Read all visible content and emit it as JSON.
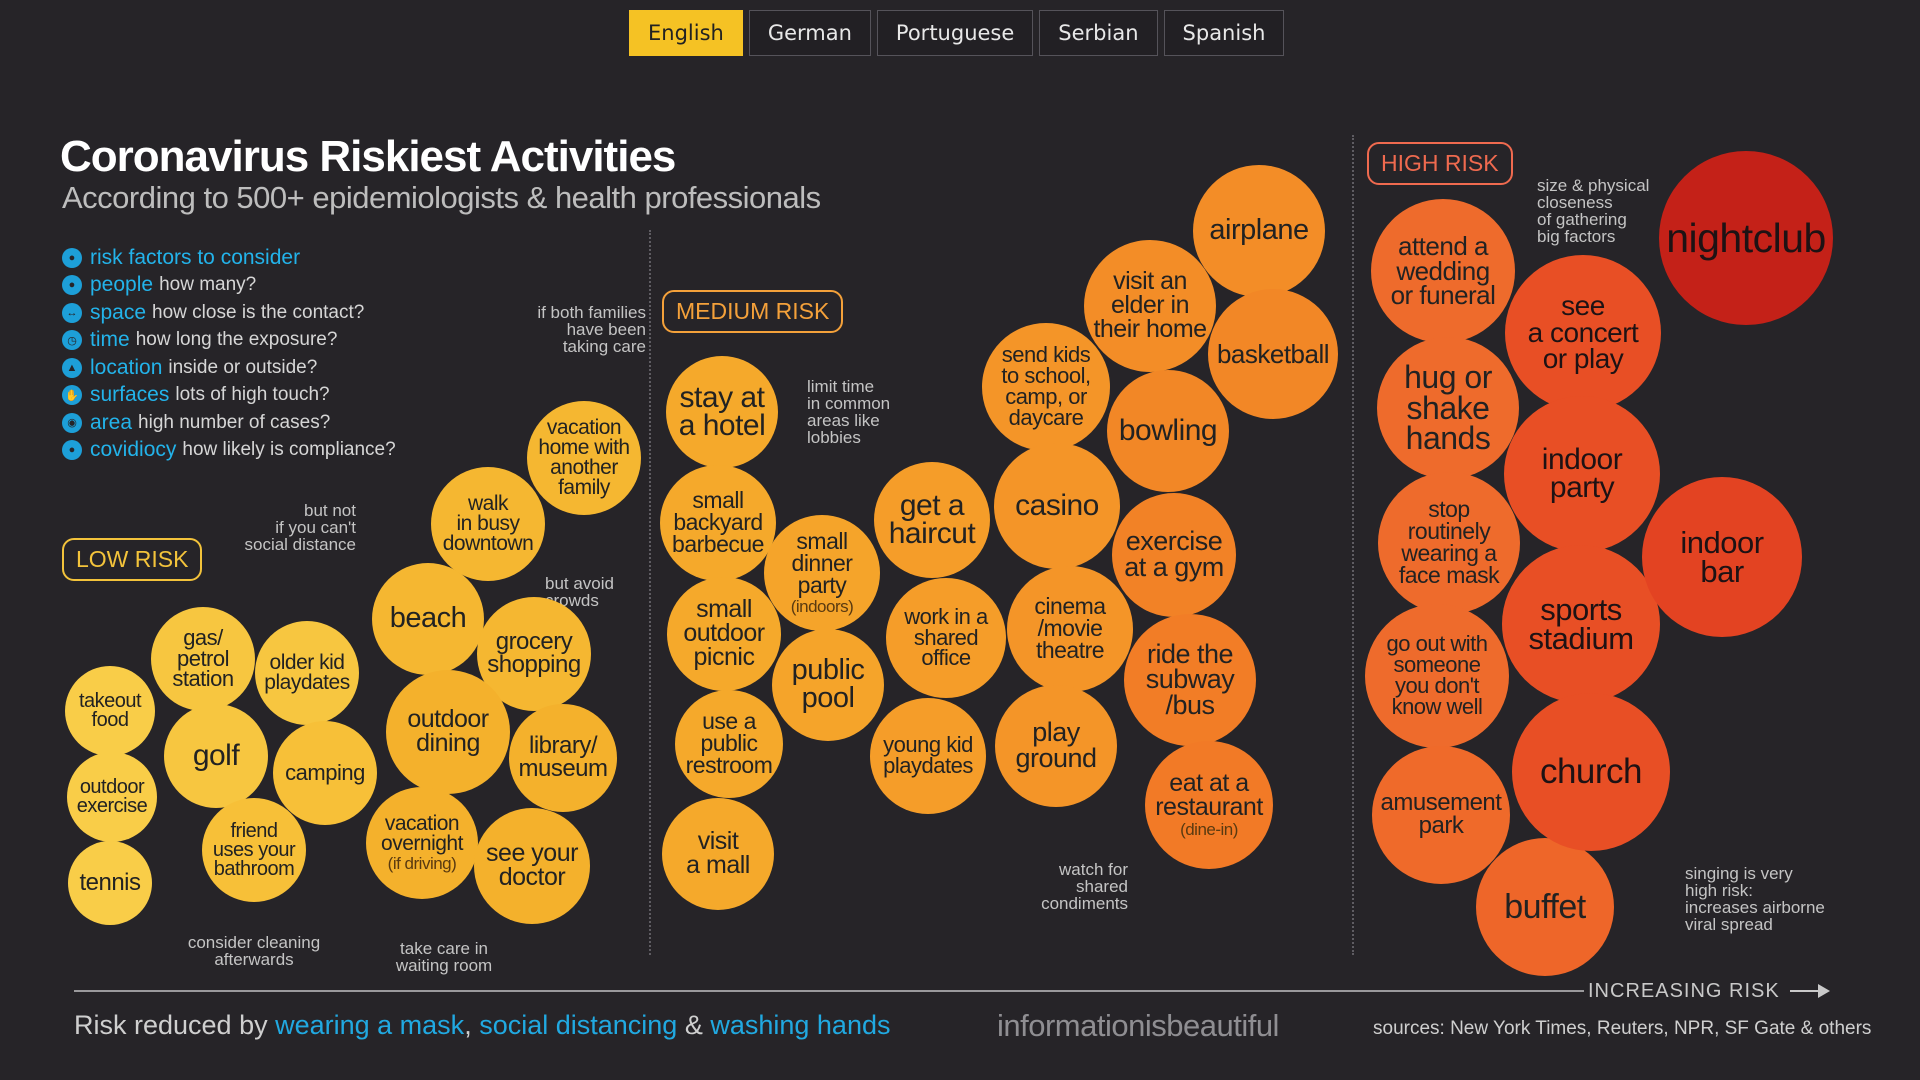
{
  "languages": [
    "English",
    "German",
    "Portuguese",
    "Serbian",
    "Spanish"
  ],
  "title": "Coronavirus Riskiest Activities",
  "subtitle": "According to 500+ epidemiologists & health professionals",
  "risk_factors": [
    {
      "key": "risk factors to consider",
      "desc": ""
    },
    {
      "key": "people",
      "desc": "how many?"
    },
    {
      "key": "space",
      "desc": "how close is the contact?"
    },
    {
      "key": "time",
      "desc": "how long the exposure?"
    },
    {
      "key": "location",
      "desc": "inside or outside?"
    },
    {
      "key": "surfaces",
      "desc": "lots of high touch?"
    },
    {
      "key": "area",
      "desc": "high number of cases?"
    },
    {
      "key": "covidiocy",
      "desc": "how likely is compliance?"
    }
  ],
  "risk_labels": {
    "low": "LOW RISK",
    "medium": "MEDIUM RISK",
    "high": "HIGH RISK"
  },
  "notes": {
    "both_families": "if both families\nhave been\ntaking care",
    "but_not": "but not\nif you can't\nsocial distance",
    "avoid_crowds": "but avoid\ncrowds",
    "cleaning": "consider cleaning\nafterwards",
    "waiting_room": "take care in\nwaiting room",
    "limit_time": "limit time\nin common\nareas like\nlobbies",
    "condiments": "watch for\nshared\ncondiments",
    "gathering": "size & physical\ncloseness\nof gathering\nbig factors",
    "singing": "singing is very\nhigh risk:\nincreases airborne\nviral spread"
  },
  "activities": [
    {
      "label": "takeout\nfood",
      "sub": "",
      "level": "low",
      "color": "#f9cd48"
    },
    {
      "label": "outdoor\nexercise",
      "sub": "",
      "level": "low",
      "color": "#f9cd48"
    },
    {
      "label": "tennis",
      "sub": "",
      "level": "low",
      "color": "#f9cd48"
    },
    {
      "label": "gas/\npetrol\nstation",
      "sub": "",
      "level": "low",
      "color": "#f7c640"
    },
    {
      "label": "golf",
      "sub": "",
      "level": "low",
      "color": "#f7c640"
    },
    {
      "label": "older kid\nplaydates",
      "sub": "",
      "level": "low",
      "color": "#f7c640"
    },
    {
      "label": "camping",
      "sub": "",
      "level": "low",
      "color": "#f7c038"
    },
    {
      "label": "friend\nuses your\nbathroom",
      "sub": "",
      "level": "low",
      "color": "#f7c038"
    },
    {
      "label": "beach",
      "sub": "",
      "level": "low",
      "color": "#f5b731"
    },
    {
      "label": "walk\nin busy\ndowntown",
      "sub": "",
      "level": "low",
      "color": "#f5b731"
    },
    {
      "label": "vacation\nhome with\nanother\nfamily",
      "sub": "",
      "level": "low",
      "color": "#f5b731"
    },
    {
      "label": "grocery\nshopping",
      "sub": "",
      "level": "low",
      "color": "#f5b731"
    },
    {
      "label": "outdoor\ndining",
      "sub": "",
      "level": "low",
      "color": "#f4b12c"
    },
    {
      "label": "library/\nmuseum",
      "sub": "",
      "level": "low",
      "color": "#f4b12c"
    },
    {
      "label": "vacation\novernight",
      "sub": "(if driving)",
      "level": "low",
      "color": "#f4b12c"
    },
    {
      "label": "see your\ndoctor",
      "sub": "",
      "level": "low",
      "color": "#f4b12c"
    },
    {
      "label": "stay at\na hotel",
      "sub": "",
      "level": "medium",
      "color": "#f5a92b"
    },
    {
      "label": "small\nbackyard\nbarbecue",
      "sub": "",
      "level": "medium",
      "color": "#f5a92b"
    },
    {
      "label": "small\noutdoor\npicnic",
      "sub": "",
      "level": "medium",
      "color": "#f5a92b"
    },
    {
      "label": "use a\npublic\nrestroom",
      "sub": "",
      "level": "medium",
      "color": "#f5a92b"
    },
    {
      "label": "visit\na mall",
      "sub": "",
      "level": "medium",
      "color": "#f5a92b"
    },
    {
      "label": "small\ndinner\nparty",
      "sub": "(indoors)",
      "level": "medium",
      "color": "#f5a42a"
    },
    {
      "label": "public\npool",
      "sub": "",
      "level": "medium",
      "color": "#f5a42a"
    },
    {
      "label": "get a\nhaircut",
      "sub": "",
      "level": "medium",
      "color": "#f59d29"
    },
    {
      "label": "work in a\nshared\noffice",
      "sub": "",
      "level": "medium",
      "color": "#f59d29"
    },
    {
      "label": "young kid\nplaydates",
      "sub": "",
      "level": "medium",
      "color": "#f59d29"
    },
    {
      "label": "send kids\nto school,\ncamp, or\ndaycare",
      "sub": "",
      "level": "medium",
      "color": "#f49528"
    },
    {
      "label": "casino",
      "sub": "",
      "level": "medium",
      "color": "#f49528"
    },
    {
      "label": "cinema\n/movie\ntheatre",
      "sub": "",
      "level": "medium",
      "color": "#f49528"
    },
    {
      "label": "play\nground",
      "sub": "",
      "level": "medium",
      "color": "#f49528"
    },
    {
      "label": "visit an\nelder in\ntheir home",
      "sub": "",
      "level": "medium",
      "color": "#f38d27"
    },
    {
      "label": "airplane",
      "sub": "",
      "level": "medium",
      "color": "#f38d27"
    },
    {
      "label": "basketball",
      "sub": "",
      "level": "medium",
      "color": "#f28726"
    },
    {
      "label": "bowling",
      "sub": "",
      "level": "medium",
      "color": "#f28726"
    },
    {
      "label": "exercise\nat a gym",
      "sub": "",
      "level": "medium",
      "color": "#f28226"
    },
    {
      "label": "ride the\nsubway\n/bus",
      "sub": "",
      "level": "medium",
      "color": "#f27d26"
    },
    {
      "label": "eat at a\nrestaurant",
      "sub": "(dine-in)",
      "level": "medium",
      "color": "#f27a26"
    },
    {
      "label": "attend a\nwedding\nor funeral",
      "sub": "",
      "level": "high",
      "color": "#ee6b2c"
    },
    {
      "label": "hug or\nshake\nhands",
      "sub": "",
      "level": "high",
      "color": "#ee6b2c"
    },
    {
      "label": "stop\nroutinely\nwearing a\nface mask",
      "sub": "",
      "level": "high",
      "color": "#ee6b2c"
    },
    {
      "label": "go out with\nsomeone\nyou don't\nknow well",
      "sub": "",
      "level": "high",
      "color": "#ee6b2c"
    },
    {
      "label": "amusement\npark",
      "sub": "",
      "level": "high",
      "color": "#ef6a2a"
    },
    {
      "label": "buffet",
      "sub": "",
      "level": "high",
      "color": "#ee6629"
    },
    {
      "label": "see\na concert\nor play",
      "sub": "",
      "level": "high",
      "color": "#e84f25"
    },
    {
      "label": "indoor\nparty",
      "sub": "",
      "level": "high",
      "color": "#e84f25"
    },
    {
      "label": "sports\nstadium",
      "sub": "",
      "level": "high",
      "color": "#e84f25"
    },
    {
      "label": "church",
      "sub": "",
      "level": "high",
      "color": "#e84f25"
    },
    {
      "label": "indoor\nbar",
      "sub": "",
      "level": "high",
      "color": "#e34322"
    },
    {
      "label": "nightclub",
      "sub": "",
      "level": "high",
      "color": "#c42118"
    }
  ],
  "axis_label": "INCREASING RISK",
  "footer": {
    "prefix": "Risk reduced by ",
    "mask": "wearing a mask",
    "sep1": ", ",
    "distancing": "social distancing",
    "sep2": " & ",
    "washing": "washing hands"
  },
  "brand": "informationisbeautiful",
  "sources": "sources: New York Times, Reuters, NPR, SF Gate & others"
}
